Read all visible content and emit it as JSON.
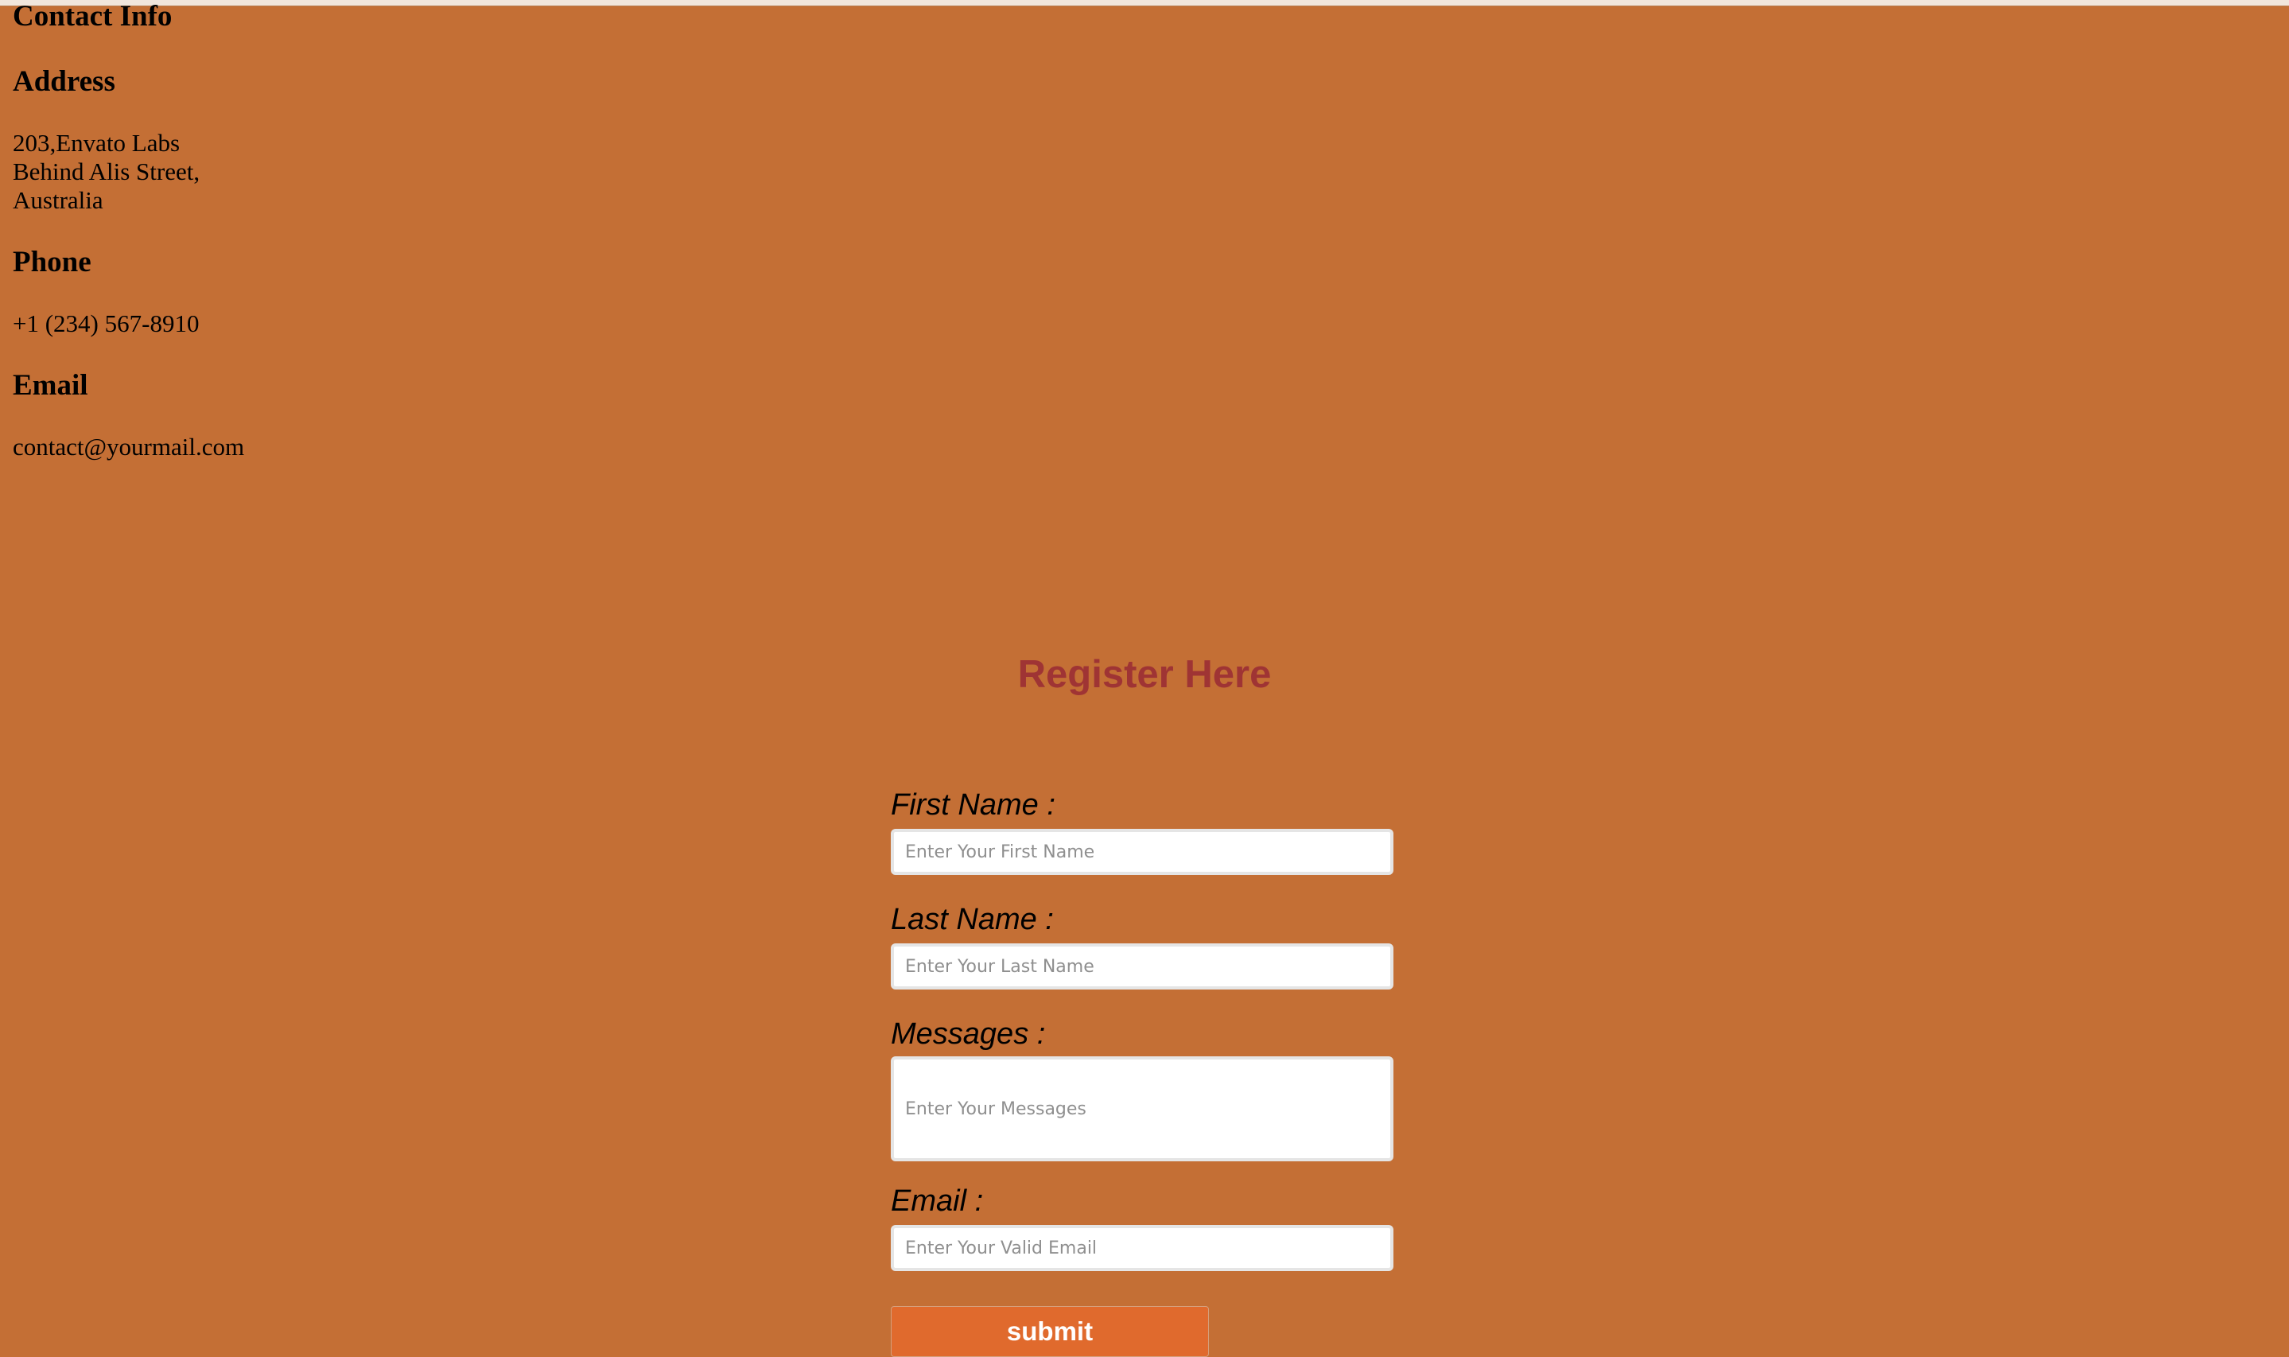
{
  "contact": {
    "title": "Contact Info",
    "address_heading": "Address",
    "address_lines": [
      "203,Envato Labs",
      "Behind Alis Street,",
      "Australia"
    ],
    "phone_heading": "Phone",
    "phone": "+1 (234) 567-8910",
    "email_heading": "Email",
    "email": "contact@yourmail.com"
  },
  "register": {
    "title": "Register Here",
    "first_name_label": "First Name :",
    "first_name_placeholder": "Enter Your First Name",
    "last_name_label": "Last Name :",
    "last_name_placeholder": "Enter Your Last Name",
    "messages_label": "Messages :",
    "messages_placeholder": "Enter Your Messages",
    "email_label": "Email :",
    "email_placeholder": "Enter Your Valid Email",
    "submit_label": "submit"
  },
  "colors": {
    "background": "#c46f35",
    "title": "#9f3434",
    "button": "#e06a2d"
  }
}
